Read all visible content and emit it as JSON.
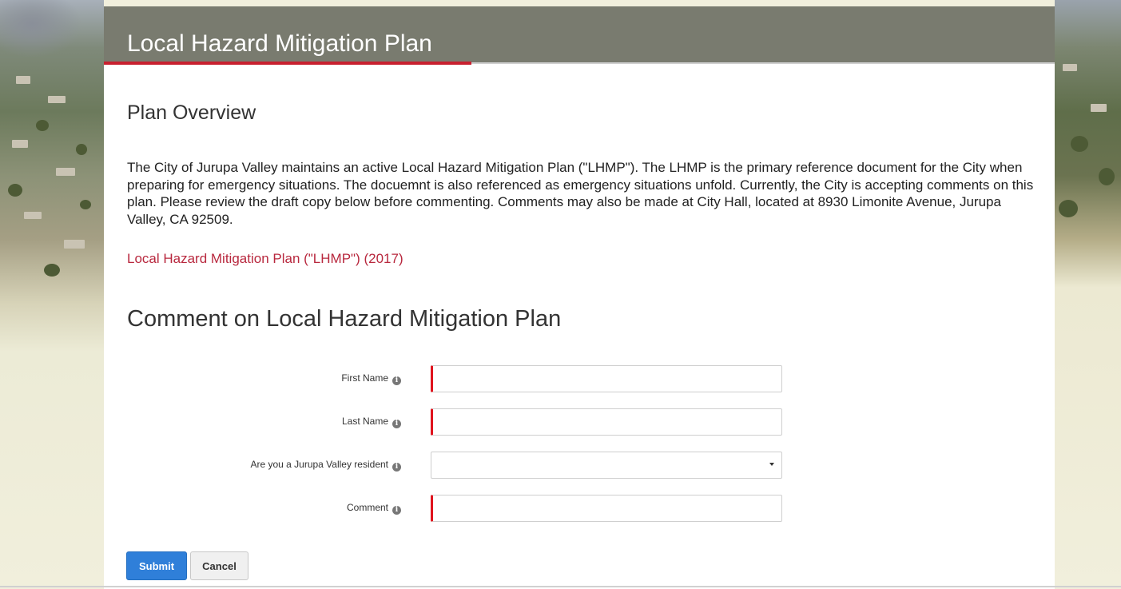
{
  "hero": {
    "title": "Local Hazard Mitigation Plan"
  },
  "overview": {
    "heading": "Plan Overview",
    "paragraph": "The City of Jurupa Valley maintains an active Local Hazard Mitigation Plan (\"LHMP\").  The LHMP is the primary reference document for the City when preparing for emergency situations.  The docuemnt is also referenced as emergency situations unfold.  Currently, the City is accepting comments on this plan.  Please review the draft copy below before commenting.  Comments may also be made at City Hall, located at 8930 Limonite Avenue, Jurupa Valley, CA 92509.",
    "link": "Local Hazard Mitigation Plan (\"LHMP\") (2017)"
  },
  "comment_form": {
    "heading": "Comment on Local Hazard Mitigation Plan",
    "fields": [
      {
        "label": "First Name",
        "value": "",
        "required": true,
        "type": "text"
      },
      {
        "label": "Last Name",
        "value": "",
        "required": true,
        "type": "text"
      },
      {
        "label": "Are you a Jurupa Valley resident",
        "value": "",
        "required": false,
        "type": "select"
      },
      {
        "label": "Comment",
        "value": "",
        "required": true,
        "type": "text"
      }
    ],
    "info_icon": "info-icon",
    "submit_label": "Submit",
    "cancel_label": "Cancel"
  },
  "colors": {
    "hero_bg": "#797b6f",
    "accent_red": "#c8202f",
    "link": "#b8283e",
    "required_marker": "#e0141e",
    "submit_bg": "#2f7fd9"
  }
}
